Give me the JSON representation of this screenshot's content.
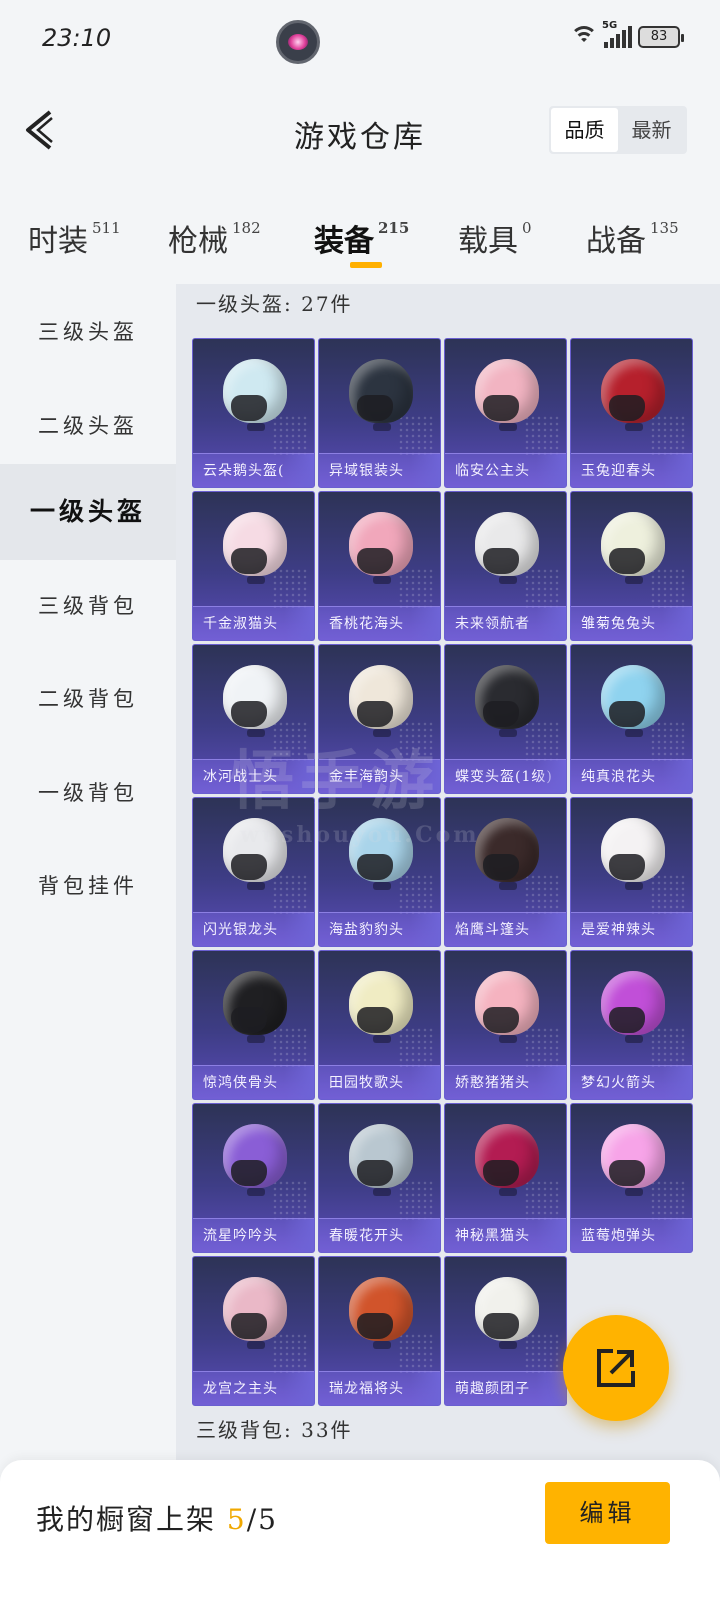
{
  "status": {
    "time": "23:10",
    "network": "5G",
    "battery": "83"
  },
  "header": {
    "title": "游戏仓库",
    "sort": [
      "品质",
      "最新"
    ]
  },
  "tabs": [
    {
      "label": "时装",
      "count": "511"
    },
    {
      "label": "枪械",
      "count": "182"
    },
    {
      "label": "装备",
      "count": "215"
    },
    {
      "label": "载具",
      "count": "0"
    },
    {
      "label": "战备",
      "count": "135"
    }
  ],
  "sidebar": [
    "三级头盔",
    "二级头盔",
    "一级头盔",
    "三级背包",
    "二级背包",
    "一级背包",
    "背包挂件"
  ],
  "sections": {
    "helmet_title": "一级头盔: 27件",
    "backpack_title": "三级背包: 33件"
  },
  "items": [
    {
      "name": "云朵鹅头盔(",
      "color": "#cfe9f1"
    },
    {
      "name": "异域银装头",
      "color": "#2c3440"
    },
    {
      "name": "临安公主头",
      "color": "#f2b4c2"
    },
    {
      "name": "玉兔迎春头",
      "color": "#b6202c"
    },
    {
      "name": "千金淑猫头",
      "color": "#f6dbe4"
    },
    {
      "name": "香桃花海头",
      "color": "#f1a7bb"
    },
    {
      "name": "未来领航者",
      "color": "#e9e9ea"
    },
    {
      "name": "雏菊兔兔头",
      "color": "#eef0dd"
    },
    {
      "name": "冰河战士头",
      "color": "#f0f3f6"
    },
    {
      "name": "金丰海韵头",
      "color": "#efe7da"
    },
    {
      "name": "蝶变头盔(1级)",
      "color": "#2a2b30"
    },
    {
      "name": "纯真浪花头",
      "color": "#8fd3ef"
    },
    {
      "name": "闪光银龙头",
      "color": "#e8e9ec"
    },
    {
      "name": "海盐豹豹头",
      "color": "#a9d4ea"
    },
    {
      "name": "焰鹰斗篷头",
      "color": "#3b2a2a"
    },
    {
      "name": "是爱神辣头",
      "color": "#f4f2f3"
    },
    {
      "name": "惊鸿侠骨头",
      "color": "#1f1f22"
    },
    {
      "name": "田园牧歌头",
      "color": "#f0ecc3"
    },
    {
      "name": "娇憨猪猪头",
      "color": "#f5b3c0"
    },
    {
      "name": "梦幻火箭头",
      "color": "#c14fd8"
    },
    {
      "name": "流星吟吟头",
      "color": "#8a5ed6"
    },
    {
      "name": "春暖花开头",
      "color": "#b9c7d0"
    },
    {
      "name": "神秘黑猫头",
      "color": "#b31c52"
    },
    {
      "name": "蓝莓炮弹头",
      "color": "#f7a4e8"
    },
    {
      "name": "龙宫之主头",
      "color": "#eab8c7"
    },
    {
      "name": "瑞龙福将头",
      "color": "#d1542b"
    },
    {
      "name": "萌趣颜团子",
      "color": "#f1f1ec"
    }
  ],
  "bottom": {
    "label": "我的橱窗上架",
    "count_current": "5",
    "count_total": "/5",
    "edit": "编辑"
  },
  "watermark": {
    "main": "悟手游",
    "sub": "wushouyou.Com"
  }
}
